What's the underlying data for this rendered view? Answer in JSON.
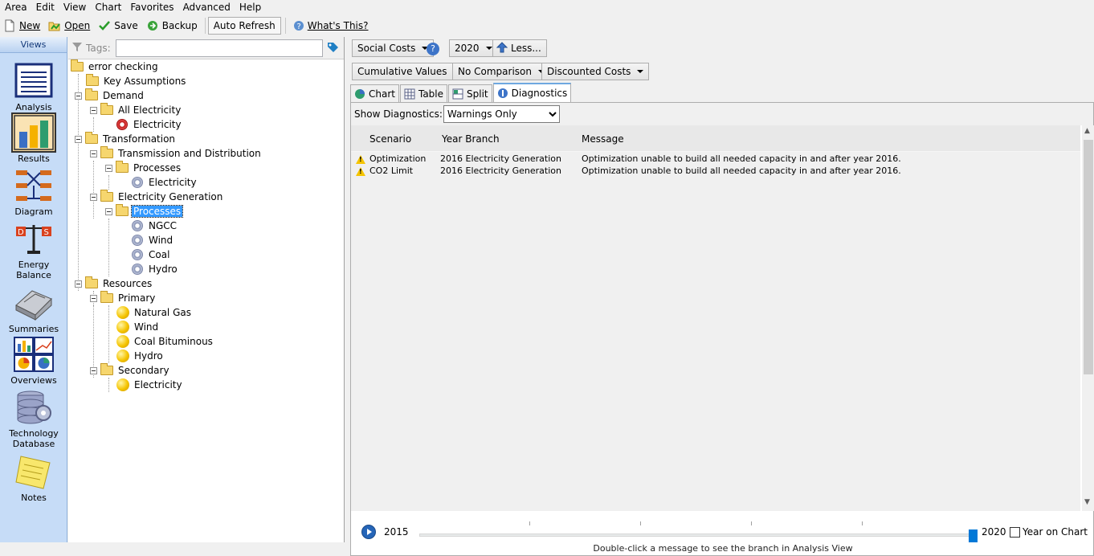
{
  "menu": [
    "Area",
    "Edit",
    "View",
    "Chart",
    "Favorites",
    "Advanced",
    "Help"
  ],
  "toolbar": {
    "new": "New",
    "open": "Open",
    "save": "Save",
    "backup": "Backup",
    "auto_refresh": "Auto Refresh",
    "whats_this": "What's This?"
  },
  "views": {
    "title": "Views",
    "items": [
      {
        "label": "Analysis",
        "icon": "analysis-icon"
      },
      {
        "label": "Results",
        "icon": "results-icon",
        "selected": true
      },
      {
        "label": "Diagram",
        "icon": "diagram-icon"
      },
      {
        "label": "Energy Balance",
        "icon": "energy-balance-icon"
      },
      {
        "label": "Summaries",
        "icon": "summaries-icon"
      },
      {
        "label": "Overviews",
        "icon": "overviews-icon"
      },
      {
        "label": "Technology Database",
        "icon": "technology-database-icon"
      },
      {
        "label": "Notes",
        "icon": "notes-icon"
      }
    ]
  },
  "tags": {
    "label": "Tags:",
    "value": ""
  },
  "tree": {
    "root": "error checking",
    "key_assumptions": "Key Assumptions",
    "demand": "Demand",
    "all_electricity": "All Electricity",
    "demand_electricity": "Electricity",
    "transformation": "Transformation",
    "td": "Transmission and Distribution",
    "td_processes": "Processes",
    "td_electricity": "Electricity",
    "elec_gen": "Electricity Generation",
    "eg_processes": "Processes",
    "ngcc": "NGCC",
    "wind": "Wind",
    "coal": "Coal",
    "hydro": "Hydro",
    "resources": "Resources",
    "primary": "Primary",
    "natural_gas": "Natural Gas",
    "p_wind": "Wind",
    "coal_bituminous": "Coal Bituminous",
    "p_hydro": "Hydro",
    "secondary": "Secondary",
    "s_electricity": "Electricity"
  },
  "controls": {
    "variable": "Social Costs",
    "year": "2020",
    "less": "Less...",
    "values": "Cumulative Values",
    "comparison": "No Comparison",
    "costs": "Discounted Costs"
  },
  "tabs": [
    "Chart",
    "Table",
    "Split",
    "Diagnostics"
  ],
  "diagnostics": {
    "show_label": "Show Diagnostics:",
    "filter": "Warnings Only",
    "columns": [
      "Scenario",
      "Year Branch",
      "Message"
    ],
    "rows": [
      {
        "scenario": "Optimization",
        "branch": "2016 Electricity Generation",
        "message": "Optimization unable to build all needed capacity in and after year 2016."
      },
      {
        "scenario": "CO2 Limit",
        "branch": "2016 Electricity Generation",
        "message": "Optimization unable to build all needed capacity in and after year 2016."
      }
    ],
    "hint": "Double-click a message to see the branch in Analysis View"
  },
  "timeline": {
    "start": "2015",
    "end": "2020",
    "year_on_chart": "Year on Chart"
  }
}
